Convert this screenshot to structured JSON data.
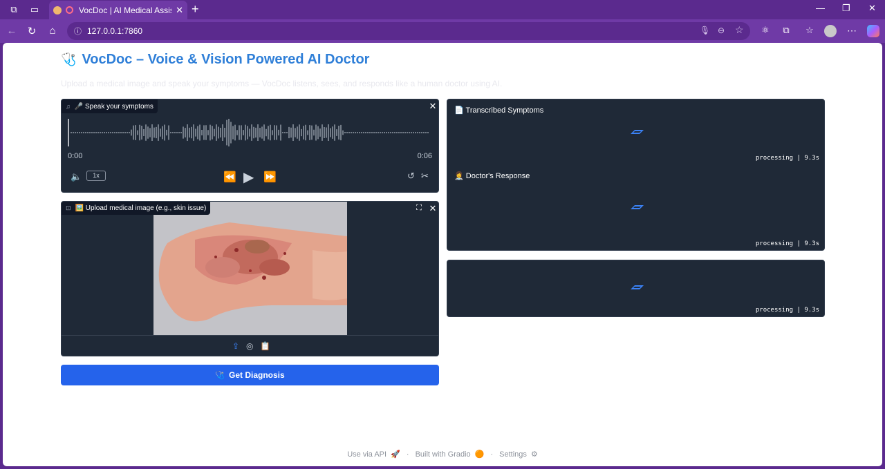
{
  "browser": {
    "tab_title": "VocDoc | AI Medical Assistan",
    "url": "127.0.0.1:7860"
  },
  "page": {
    "title": "VocDoc – Voice & Vision Powered AI Doctor",
    "subtitle": "Upload a medical image and speak your symptoms — VocDoc listens, sees, and responds like a human doctor using AI."
  },
  "audio": {
    "label": "🎤 Speak your symptoms",
    "time_start": "0:00",
    "time_end": "0:06",
    "speed": "1x"
  },
  "image_input": {
    "label": "🖼️ Upload medical image (e.g., skin issue)"
  },
  "diagnose_button": {
    "label": "Get Diagnosis",
    "icon": "🩺"
  },
  "outputs": {
    "transcribed_label": "📄 Transcribed Symptoms",
    "transcribed_status": "processing | 9.3s",
    "response_label": "👩‍⚕️ Doctor's Response",
    "response_status": "processing | 9.3s",
    "audio_status": "processing | 9.3s"
  },
  "footer": {
    "api": "Use via API",
    "gradio": "Built with Gradio",
    "settings": "Settings",
    "sep": "·"
  },
  "colors": {
    "accent": "#2563eb",
    "title_blue": "#2f7fd8",
    "panel_bg": "#1f2937",
    "browser_purple": "#5b2a8e"
  }
}
